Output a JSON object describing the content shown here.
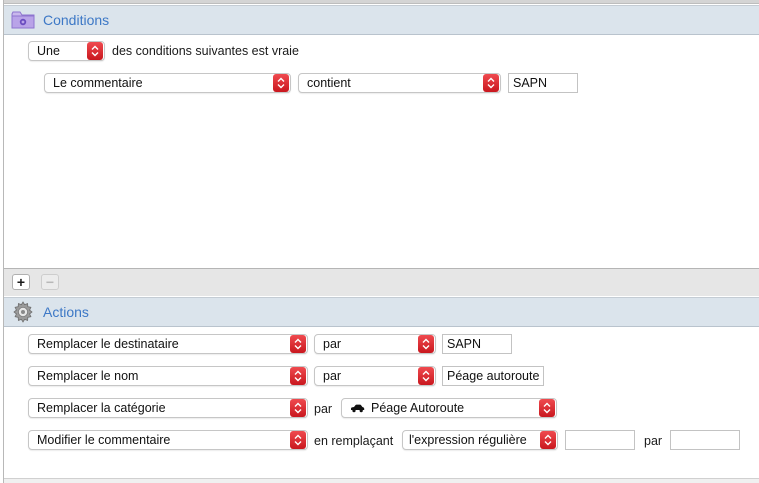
{
  "conditions": {
    "title": "Conditions",
    "icon": "folder-icon",
    "match_mode": "Une",
    "match_suffix": "des conditions suivantes est vraie",
    "rules": [
      {
        "field": "Le commentaire",
        "operator": "contient",
        "value": "SAPN"
      }
    ],
    "add_symbol": "+",
    "remove_symbol": "−"
  },
  "actions": {
    "title": "Actions",
    "icon": "gear-icon",
    "rows": [
      {
        "action": "Remplacer le destinataire",
        "connector": "par",
        "value": "SAPN"
      },
      {
        "action": "Remplacer le nom",
        "connector": "par",
        "value": "Péage autoroute"
      },
      {
        "action": "Remplacer la catégorie",
        "connector": "par",
        "category": "Péage Autoroute",
        "category_icon": "car-icon"
      },
      {
        "action": "Modifier le commentaire",
        "connector": "en remplaçant",
        "mode": "l'expression régulière",
        "find_value": "",
        "connector2": "par",
        "replace_value": ""
      }
    ]
  },
  "colors": {
    "accent": "#3d78c6",
    "stepper": "#d8262c",
    "header_bg": "#dbe4ec"
  }
}
